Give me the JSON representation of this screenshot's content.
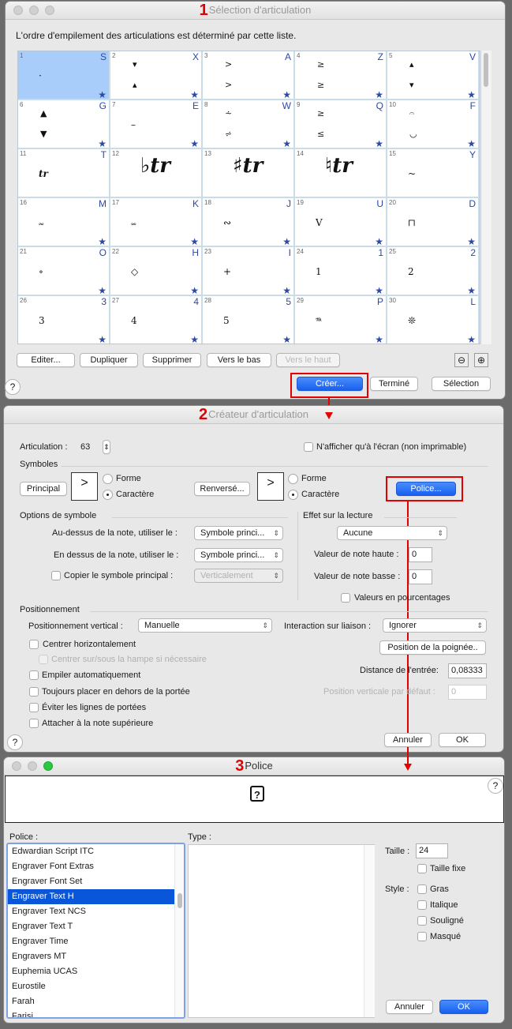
{
  "window1": {
    "number": "1",
    "title": "Sélection d'articulation",
    "description": "L'ordre d'empilement des articulations est déterminé par cette liste.",
    "cells": [
      {
        "n": "1",
        "key": "S",
        "glyph": "·",
        "star": true,
        "selected": true
      },
      {
        "n": "2",
        "key": "X",
        "glyph": "▾ ▴",
        "star": true
      },
      {
        "n": "3",
        "key": "A",
        "glyph": "> >",
        "star": true
      },
      {
        "n": "4",
        "key": "Z",
        "glyph": "≥ ≥",
        "star": true
      },
      {
        "n": "5",
        "key": "V",
        "glyph": "▴ ▾",
        "star": true
      },
      {
        "n": "6",
        "key": "G",
        "glyph": "▲ ▼",
        "star": true
      },
      {
        "n": "7",
        "key": "E",
        "glyph": "–",
        "star": true
      },
      {
        "n": "8",
        "key": "W",
        "glyph": "⩪ ⩫",
        "star": true
      },
      {
        "n": "9",
        "key": "Q",
        "glyph": "≥ ≤",
        "star": true
      },
      {
        "n": "10",
        "key": "F",
        "glyph": "𝄐 ◡",
        "star": true
      },
      {
        "n": "11",
        "key": "T",
        "glyph": "tr",
        "star": false
      },
      {
        "n": "12",
        "key": "",
        "glyph": "♭tr",
        "star": false
      },
      {
        "n": "13",
        "key": "",
        "glyph": "♯tr",
        "star": false
      },
      {
        "n": "14",
        "key": "",
        "glyph": "♮tr",
        "star": false
      },
      {
        "n": "15",
        "key": "Y",
        "glyph": "~",
        "star": false
      },
      {
        "n": "16",
        "key": "M",
        "glyph": "𝆗",
        "star": true
      },
      {
        "n": "17",
        "key": "K",
        "glyph": "𝆘",
        "star": true
      },
      {
        "n": "18",
        "key": "J",
        "glyph": "∾",
        "star": true
      },
      {
        "n": "19",
        "key": "U",
        "glyph": "V",
        "star": true
      },
      {
        "n": "20",
        "key": "D",
        "glyph": "⊓",
        "star": true
      },
      {
        "n": "21",
        "key": "O",
        "glyph": "∘",
        "star": true
      },
      {
        "n": "22",
        "key": "H",
        "glyph": "◇",
        "star": true
      },
      {
        "n": "23",
        "key": "I",
        "glyph": "+",
        "star": true
      },
      {
        "n": "24",
        "key": "1",
        "glyph": "1",
        "star": true
      },
      {
        "n": "25",
        "key": "2",
        "glyph": "2",
        "star": true
      },
      {
        "n": "26",
        "key": "3",
        "glyph": "3",
        "star": true
      },
      {
        "n": "27",
        "key": "4",
        "glyph": "4",
        "star": true
      },
      {
        "n": "28",
        "key": "5",
        "glyph": "5",
        "star": true
      },
      {
        "n": "29",
        "key": "P",
        "glyph": "𝆮",
        "star": true
      },
      {
        "n": "30",
        "key": "L",
        "glyph": "❊",
        "star": true
      }
    ],
    "star_glyph": "★",
    "buttons": {
      "edit": "Editer...",
      "duplicate": "Dupliquer",
      "delete": "Supprimer",
      "move_down": "Vers le bas",
      "move_up": "Vers le haut",
      "create": "Créer...",
      "done": "Terminé",
      "select": "Sélection"
    },
    "help": "?",
    "zoom_out_icon": "⊖",
    "zoom_in_icon": "⊕"
  },
  "window2": {
    "number": "2",
    "title": "Créateur d'articulation",
    "articulation_label": "Articulation :",
    "articulation_value": "63",
    "screen_only_label": "N'afficher qu'à l'écran (non imprimable)",
    "symbols_section": "Symboles",
    "main_button": "Principal",
    "main_symbol": ">",
    "flipped_button": "Renversé...",
    "flipped_symbol": ">",
    "shape_label": "Forme",
    "char_label": "Caractère",
    "font_button": "Police...",
    "symbol_options_section": "Options de symbole",
    "above_label": "Au-dessus de la note, utiliser le :",
    "above_value": "Symbole princi...",
    "below_label": "En dessus de la note, utiliser le :",
    "below_value": "Symbole princi...",
    "copy_main_label": "Copier le symbole principal :",
    "copy_main_value": "Verticalement",
    "playback_section": "Effet sur la lecture",
    "playback_value": "Aucune",
    "top_note_label": "Valeur de note haute :",
    "top_note_value": "0",
    "bottom_note_label": "Valeur de note basse :",
    "bottom_note_value": "0",
    "percent_label": "Valeurs en pourcentages",
    "positioning_section": "Positionnement",
    "vertical_pos_label": "Positionnement vertical :",
    "vertical_pos_value": "Manuelle",
    "tie_label": "Interaction sur liaison :",
    "tie_value": "Ignorer",
    "center_h_label": "Centrer horizontalement",
    "center_stem_label": "Centrer sur/sous la hampe si nécessaire",
    "handle_button": "Position de la poignée..",
    "auto_stack_label": "Empiler automatiquement",
    "entry_distance_label": "Distance de l'entrée:",
    "entry_distance_value": "0,08333",
    "outside_staff_label": "Toujours placer en dehors de la portée",
    "default_vpos_label": "Position verticale par défaut :",
    "default_vpos_value": "0",
    "avoid_staff_label": "Éviter les lignes de portées",
    "attach_top_label": "Attacher à la note supérieure",
    "cancel": "Annuler",
    "ok": "OK",
    "help": "?",
    "stepper_icon": "⇕"
  },
  "window3": {
    "number": "3",
    "title": "Police",
    "preview_glyph": "?",
    "help": "?",
    "font_label": "Police :",
    "type_label": "Type :",
    "fonts": [
      "Edwardian Script ITC",
      "Engraver Font Extras",
      "Engraver Font Set",
      "Engraver Text H",
      "Engraver Text NCS",
      "Engraver Text T",
      "Engraver Time",
      "Engravers MT",
      "Euphemia UCAS",
      "Eurostile",
      "Farah",
      "Farisi"
    ],
    "selected_font": "Engraver Text H",
    "size_label": "Taille :",
    "size_value": "24",
    "fixed_size_label": "Taille fixe",
    "style_label": "Style :",
    "bold_label": "Gras",
    "italic_label": "Italique",
    "underline_label": "Souligné",
    "hidden_label": "Masqué",
    "cancel": "Annuler",
    "ok": "OK"
  },
  "colors": {
    "annotation_red": "#e30000",
    "accent_blue": "#1760f0",
    "shortcut_blue": "#2b4aa8",
    "selected_cell": "#a9cdfb"
  }
}
